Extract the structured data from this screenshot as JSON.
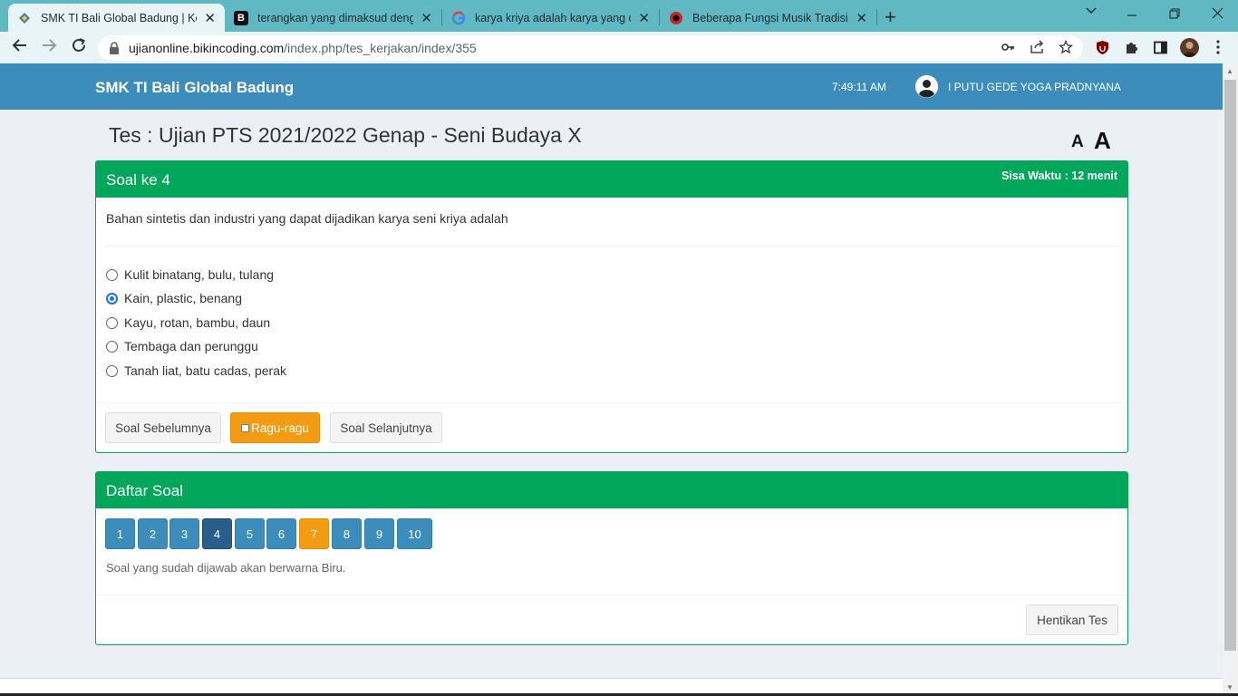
{
  "browser": {
    "tabs": [
      {
        "title": "SMK TI Bali Global Badung | Kerja",
        "favicon": "school-logo-icon",
        "active": true
      },
      {
        "title": "terangkan yang dimaksud denga",
        "favicon": "brainly-icon",
        "active": false
      },
      {
        "title": "karya kriya adalah karya yang dib",
        "favicon": "google-icon",
        "active": false
      },
      {
        "title": "Beberapa Fungsi Musik Tradision",
        "favicon": "news-icon",
        "active": false
      }
    ],
    "close_glyph": "✕",
    "new_tab_glyph": "+",
    "url_host": "ujianonline.bikincoding.com",
    "url_path": "/index.php/tes_kerjakan/index/355",
    "favicon_letters": {
      "brainly": "B"
    }
  },
  "app": {
    "brand": "SMK TI Bali Global Badung",
    "time": "7:49:11 AM",
    "user_name": "I PUTU GEDE YOGA PRADNYANA",
    "colors": {
      "primary": "#3c8dbc",
      "success": "#00a65a",
      "warning": "#f39c12",
      "active": "#285f8a"
    }
  },
  "test": {
    "title": "Tes : Ujian PTS 2021/2022 Genap - Seni Budaya X",
    "font_small": "A",
    "font_large": "A"
  },
  "question_box": {
    "header": "Soal ke 4",
    "time_left": "Sisa Waktu : 12 menit",
    "question": "Bahan sintetis dan industri yang dapat dijadikan karya seni kriya adalah",
    "options": [
      {
        "label": "Kulit binatang, bulu, tulang",
        "checked": false
      },
      {
        "label": "Kain, plastic, benang",
        "checked": true
      },
      {
        "label": "Kayu, rotan, bambu, daun",
        "checked": false
      },
      {
        "label": "Tembaga dan perunggu",
        "checked": false
      },
      {
        "label": "Tanah liat, batu cadas, perak",
        "checked": false
      }
    ],
    "prev_label": "Soal Sebelumnya",
    "doubt_label": "Ragu-ragu",
    "next_label": "Soal Selanjutnya"
  },
  "list_box": {
    "header": "Daftar Soal",
    "numbers": [
      {
        "label": "1",
        "state": "answered"
      },
      {
        "label": "2",
        "state": "answered"
      },
      {
        "label": "3",
        "state": "answered"
      },
      {
        "label": "4",
        "state": "current"
      },
      {
        "label": "5",
        "state": "answered"
      },
      {
        "label": "6",
        "state": "answered"
      },
      {
        "label": "7",
        "state": "doubt"
      },
      {
        "label": "8",
        "state": "answered"
      },
      {
        "label": "9",
        "state": "answered"
      },
      {
        "label": "10",
        "state": "answered"
      }
    ],
    "note": "Soal yang sudah dijawab akan berwarna Biru.",
    "stop_label": "Hentikan Tes"
  }
}
